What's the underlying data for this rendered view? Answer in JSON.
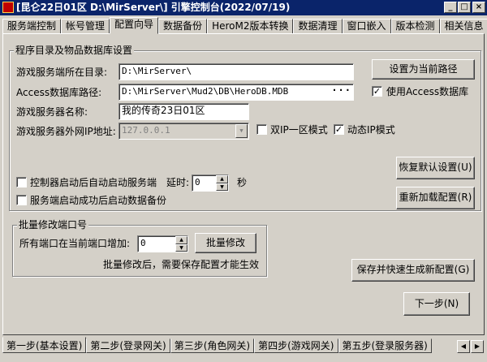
{
  "window": {
    "title": "[昆仑22日01区 D:\\MirServer\\] 引擎控制台(2022/07/19)",
    "controls": [
      "_",
      "□",
      "×"
    ]
  },
  "top_tabs": [
    "服务端控制",
    "帐号管理",
    "配置向导",
    "数据备份",
    "HeroM2版本转换",
    "数据清理",
    "窗口嵌入",
    "版本检测",
    "相关信息"
  ],
  "top_tabs_active": "配置向导",
  "db_group": {
    "legend": "程序目录及物品数据库设置",
    "dir_label": "游戏服务端所在目录:",
    "dir_value": "D:\\MirServer\\",
    "set_current_path_button": "设置为当前路径",
    "access_label": "Access数据库路径:",
    "access_value": "D:\\MirServer\\Mud2\\DB\\HeroDB.MDB",
    "use_access_label": "使用Access数据库",
    "use_access_checked": true,
    "server_name_label": "游戏服务器名称:",
    "server_name_value": "我的传奇23日01区",
    "ip_label": "游戏服务器外网IP地址:",
    "ip_value": "127.0.0.1",
    "dual_ip_label": "双IP一区模式",
    "dual_ip_checked": false,
    "dynamic_ip_label": "动态IP模式",
    "dynamic_ip_checked": true,
    "restore_default_button": "恢复默认设置(U)",
    "auto_start_label": "控制器启动后自动启动服务端",
    "auto_start_checked": false,
    "delay_label": "延时:",
    "delay_value": "0",
    "delay_unit": "秒",
    "auto_backup_label": "服务端启动成功后启动数据备份",
    "auto_backup_checked": false,
    "reload_config_button": "重新加载配置(R)"
  },
  "port_group": {
    "legend": "批量修改端口号",
    "increase_label": "所有端口在当前端口增加:",
    "increase_value": "0",
    "batch_modify_button": "批量修改",
    "note": "批量修改后，需要保存配置才能生效"
  },
  "save_generate_button": "保存并快速生成新配置(G)",
  "next_button": "下一步(N)",
  "bottom_tabs": [
    "第一步(基本设置)",
    "第二步(登录网关)",
    "第三步(角色网关)",
    "第四步(游戏网关)",
    "第五步(登录服务器)"
  ],
  "bottom_tabs_active": "第一步(基本设置)",
  "bottom_scroll": [
    "◀",
    "▶"
  ]
}
